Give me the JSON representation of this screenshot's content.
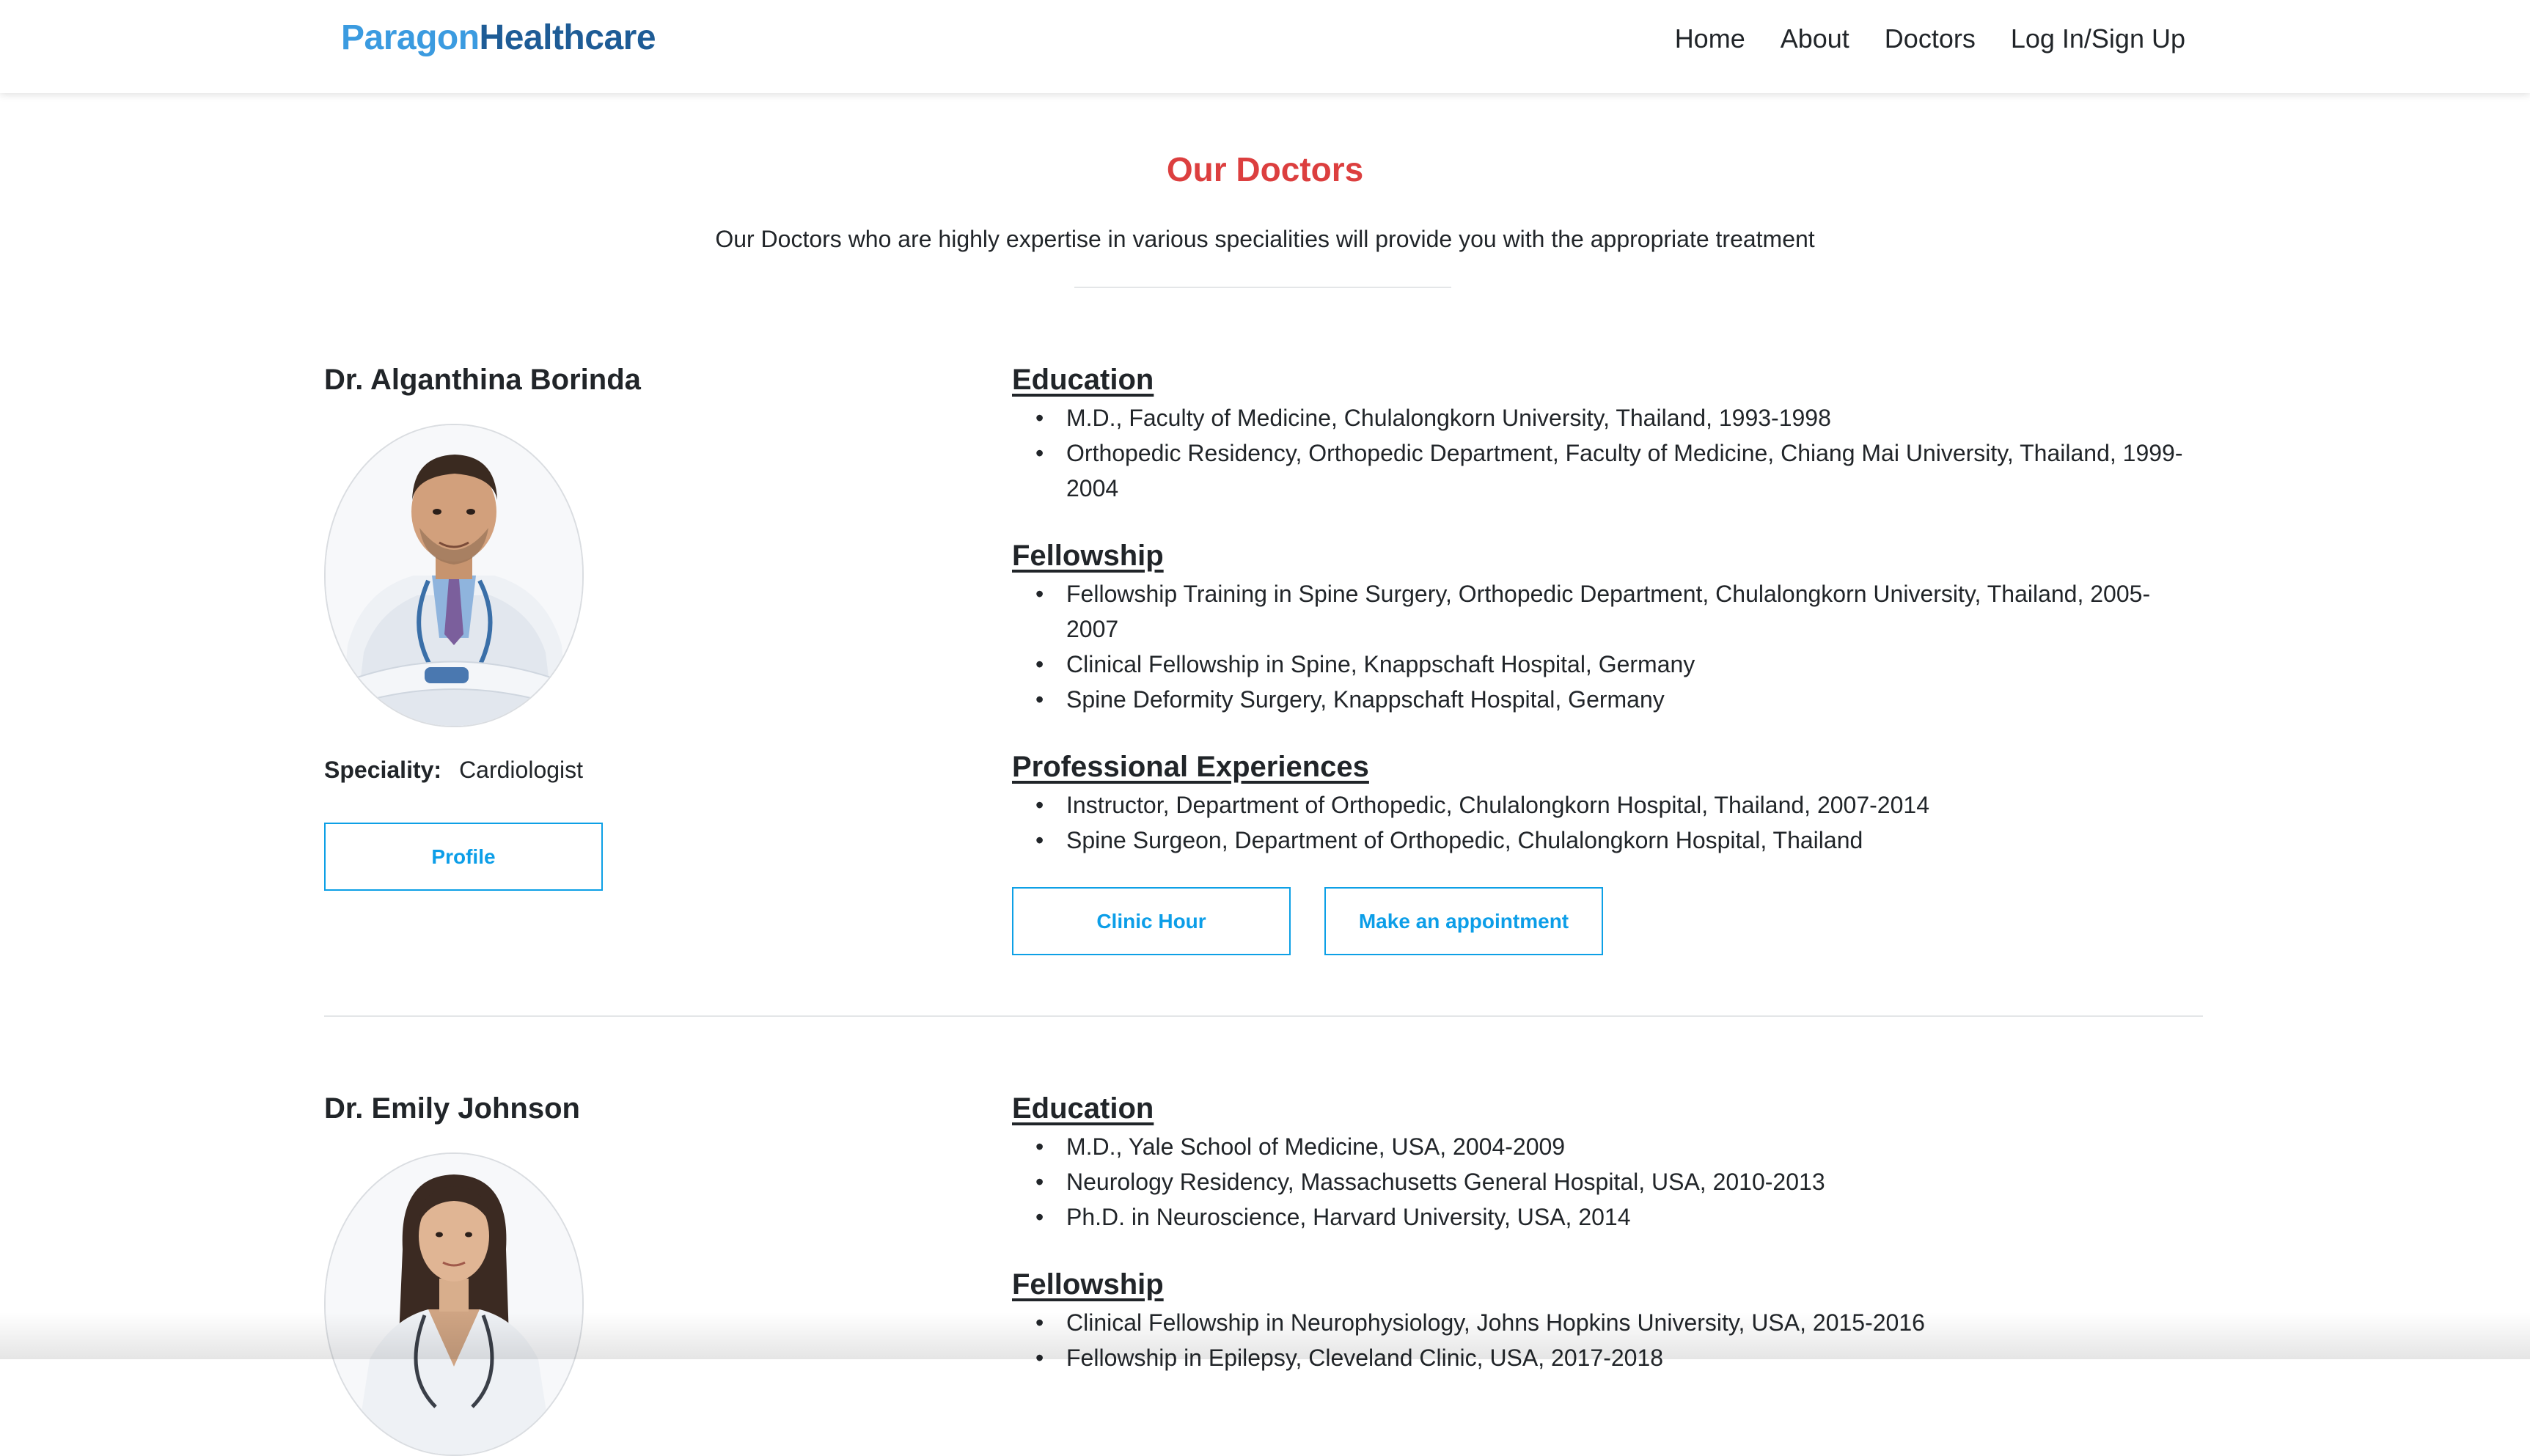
{
  "brand": {
    "part1": "Paragon",
    "part2": "Healthcare"
  },
  "nav": {
    "home": "Home",
    "about": "About",
    "doctors": "Doctors",
    "login": "Log In/Sign Up"
  },
  "page": {
    "title": "Our Doctors",
    "subtitle": "Our Doctors who are highly expertise in various specialities will provide you with the appropriate treatment"
  },
  "doctors": [
    {
      "name": "Dr. Alganthina Borinda",
      "speciality_label": "Speciality:",
      "speciality": "Cardiologist",
      "profile_label": "Profile",
      "education_title": "Education",
      "education": [
        "M.D., Faculty of Medicine, Chulalongkorn University, Thailand, 1993-1998",
        "Orthopedic Residency, Orthopedic Department, Faculty of Medicine, Chiang Mai University, Thailand, 1999-2004"
      ],
      "fellowship_title": "Fellowship",
      "fellowship": [
        "Fellowship Training in Spine Surgery, Orthopedic Department, Chulalongkorn University, Thailand, 2005-2007",
        "Clinical Fellowship in Spine, Knappschaft Hospital, Germany",
        "Spine Deformity Surgery, Knappschaft Hospital, Germany"
      ],
      "experience_title": "Professional Experiences",
      "experience": [
        "Instructor, Department of Orthopedic, Chulalongkorn Hospital, Thailand, 2007-2014",
        "Spine Surgeon, Department of Orthopedic, Chulalongkorn Hospital, Thailand"
      ],
      "clinic_hour_label": "Clinic Hour",
      "appointment_label": "Make an appointment"
    },
    {
      "name": "Dr. Emily Johnson",
      "education_title": "Education",
      "education": [
        "M.D., Yale School of Medicine, USA, 2004-2009",
        "Neurology Residency, Massachusetts General Hospital, USA, 2010-2013",
        "Ph.D. in Neuroscience, Harvard University, USA, 2014"
      ],
      "fellowship_title": "Fellowship",
      "fellowship": [
        "Clinical Fellowship in Neurophysiology, Johns Hopkins University, USA, 2015-2016",
        "Fellowship in Epilepsy, Cleveland Clinic, USA, 2017-2018"
      ]
    }
  ]
}
